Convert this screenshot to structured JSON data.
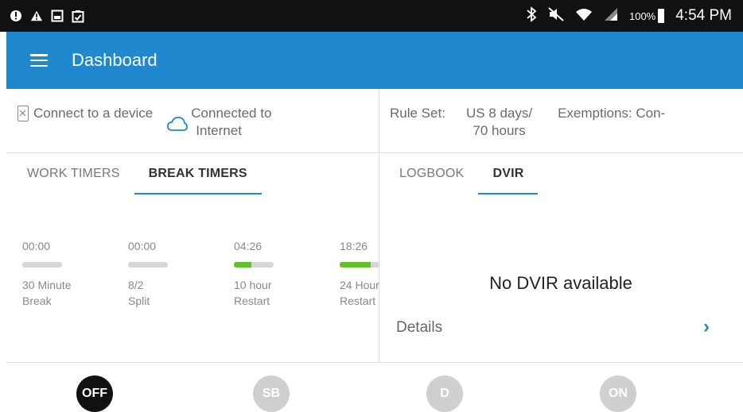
{
  "status_bar": {
    "icons": [
      "alert-circle-icon",
      "warning-icon",
      "screenshot-icon",
      "clipboard-icon"
    ],
    "right_icons": [
      "bluetooth-icon",
      "mute-icon",
      "wifi-icon",
      "signal-icon"
    ],
    "battery": "100%",
    "time": "4:54 PM"
  },
  "app_bar": {
    "title": "Dashboard",
    "color": "#1f88cf"
  },
  "info": {
    "device_label": "Connect to a device",
    "internet_line1": "Connected to",
    "internet_line2": "Internet",
    "rule_set_label": "Rule Set:",
    "rule_set_line1": "US 8 days/",
    "rule_set_line2": "70 hours",
    "exemptions": "Exemptions:  Con-"
  },
  "left_tabs": [
    {
      "label": "WORK TIMERS",
      "active": false
    },
    {
      "label": "BREAK TIMERS",
      "active": true
    }
  ],
  "right_tabs": [
    {
      "label": "LOGBOOK",
      "active": false
    },
    {
      "label": "DVIR",
      "active": true
    }
  ],
  "timers": [
    {
      "time": "00:00",
      "line1": "30 Minute",
      "line2": "Break",
      "progress": 0
    },
    {
      "time": "00:00",
      "line1": "8/2",
      "line2": "Split",
      "progress": 0
    },
    {
      "time": "04:26",
      "line1": "10 hour",
      "line2": "Restart",
      "progress": 0.44
    },
    {
      "time": "18:26",
      "line1": "24 Hour",
      "line2": "Restart",
      "progress": 0.77
    }
  ],
  "dvir": {
    "empty_text": "No DVIR available",
    "details_label": "Details",
    "chevron": "›"
  },
  "duty_status": [
    {
      "label": "OFF",
      "active": true
    },
    {
      "label": "SB",
      "active": false
    },
    {
      "label": "D",
      "active": false
    },
    {
      "label": "ON",
      "active": false
    }
  ],
  "colors": {
    "accent": "#1f88cf",
    "progress": "#62c02e",
    "active_duty": "#111111",
    "inactive_duty": "#cfcfcf"
  }
}
